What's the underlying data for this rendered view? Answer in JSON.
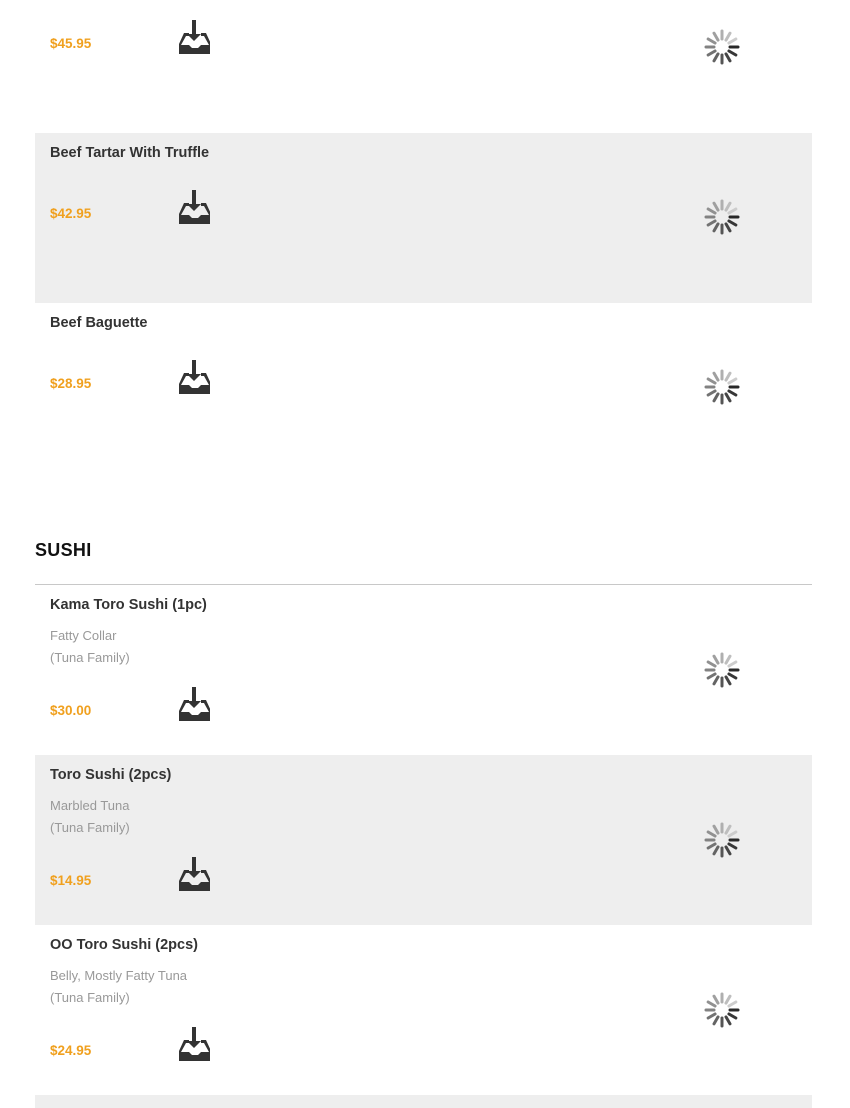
{
  "menu": {
    "top_items": [
      {
        "name": "",
        "price": "$45.95"
      },
      {
        "name": "Beef Tartar With Truffle",
        "price": "$42.95"
      },
      {
        "name": "Beef Baguette",
        "price": "$28.95"
      }
    ],
    "sushi_section": {
      "title": "SUSHI",
      "items": [
        {
          "name": "Kama Toro Sushi (1pc)",
          "desc_line1": "Fatty Collar",
          "desc_line2": "(Tuna Family)",
          "price": "$30.00"
        },
        {
          "name": "Toro Sushi (2pcs)",
          "desc_line1": "Marbled Tuna",
          "desc_line2": "(Tuna Family)",
          "price": "$14.95"
        },
        {
          "name": "OO Toro Sushi (2pcs)",
          "desc_line1": "Belly, Mostly Fatty Tuna",
          "desc_line2": "(Tuna Family)",
          "price": "$24.95"
        }
      ]
    }
  },
  "icons": {
    "add_to_cart": "inbox-download-icon",
    "image_placeholder": "loading-spinner-icon"
  },
  "colors": {
    "price": "#f0a01e",
    "row_shade": "#eeeeee",
    "divider": "#c8c8c8"
  }
}
